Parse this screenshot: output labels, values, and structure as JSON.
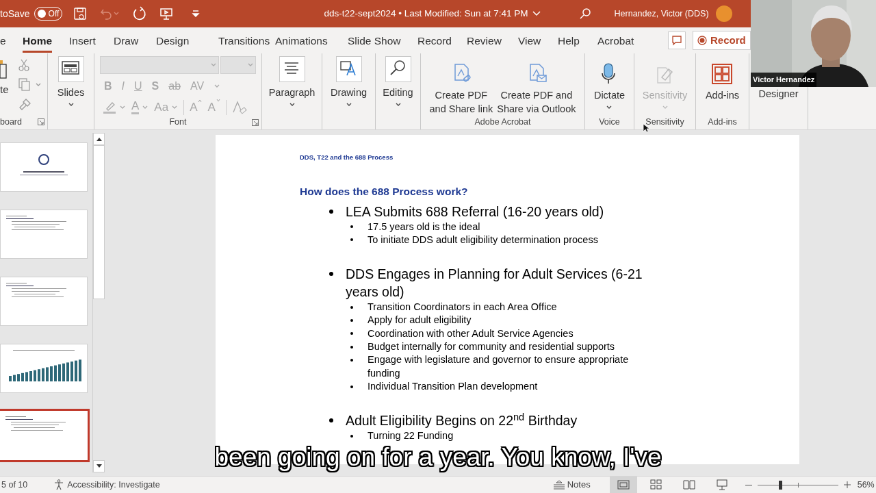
{
  "title_bar": {
    "autosave_label": "toSave",
    "autosave_toggle": {
      "label": "Off",
      "on": false
    },
    "undo_disabled": true,
    "document_title": "dds-t22-sept2024 • Last Modified: Sun at 7:41 PM",
    "user_name": "Hernandez, Victor (DDS)"
  },
  "tabs": [
    {
      "label": "e",
      "selected": false
    },
    {
      "label": "Home",
      "selected": true
    },
    {
      "label": "Insert",
      "selected": false
    },
    {
      "label": "Draw",
      "selected": false
    },
    {
      "label": "Design",
      "selected": false
    },
    {
      "label": "Transitions",
      "selected": false
    },
    {
      "label": "Animations",
      "selected": false
    },
    {
      "label": "Slide Show",
      "selected": false
    },
    {
      "label": "Record",
      "selected": false
    },
    {
      "label": "Review",
      "selected": false
    },
    {
      "label": "View",
      "selected": false
    },
    {
      "label": "Help",
      "selected": false
    },
    {
      "label": "Acrobat",
      "selected": false
    }
  ],
  "record_button": {
    "label": "Record"
  },
  "ribbon": {
    "groups": [
      {
        "kind": "clipboard",
        "label": "board",
        "paste_label": "te"
      },
      {
        "kind": "buttons",
        "buttons": [
          {
            "kind": "layout",
            "lines": [
              "Slides"
            ],
            "dropdown": true,
            "disabled": false
          }
        ]
      },
      {
        "kind": "font",
        "label": "Font",
        "row1": [
          {
            "label": "B",
            "kind": "bold",
            "disabled": true
          },
          {
            "label": "I",
            "kind": "italic",
            "disabled": true
          },
          {
            "label": "U",
            "kind": "underline",
            "disabled": true
          },
          {
            "label": "S",
            "kind": "shadow",
            "disabled": true
          },
          {
            "label": "ab",
            "kind": "strike",
            "disabled": true
          },
          {
            "label": "AV",
            "kind": "spacing",
            "disabled": true
          }
        ],
        "row2": [
          {
            "label": "A",
            "kind": "color",
            "disabled": true
          },
          {
            "label": "Aa",
            "kind": "case",
            "disabled": true
          },
          {
            "label": "A",
            "kind": "grow",
            "disabled": true
          },
          {
            "label": "A",
            "kind": "shrink",
            "disabled": true
          }
        ]
      },
      {
        "kind": "buttons",
        "buttons": [
          {
            "kind": "paragraph",
            "lines": [
              "Paragraph"
            ],
            "dropdown": true,
            "disabled": false
          }
        ]
      },
      {
        "kind": "buttons",
        "buttons": [
          {
            "kind": "drawing",
            "lines": [
              "Drawing"
            ],
            "dropdown": true,
            "disabled": false
          }
        ]
      },
      {
        "kind": "buttons",
        "buttons": [
          {
            "kind": "editing",
            "lines": [
              "Editing"
            ],
            "dropdown": true,
            "disabled": false
          }
        ]
      },
      {
        "kind": "buttons",
        "label": "Adobe Acrobat",
        "buttons": [
          {
            "kind": "pdf-link",
            "lines": [
              "Create PDF",
              "and Share link"
            ],
            "dropdown": false,
            "disabled": false
          },
          {
            "kind": "pdf-mail",
            "lines": [
              "Create PDF and",
              "Share via Outlook"
            ],
            "dropdown": false,
            "disabled": false
          }
        ]
      },
      {
        "kind": "buttons",
        "label": "Voice",
        "buttons": [
          {
            "kind": "mic",
            "lines": [
              "Dictate"
            ],
            "dropdown": true,
            "disabled": false
          }
        ]
      },
      {
        "kind": "buttons",
        "label": "Sensitivity",
        "buttons": [
          {
            "kind": "sensitivity",
            "lines": [
              "Sensitivity"
            ],
            "dropdown": true,
            "disabled": true
          }
        ]
      },
      {
        "kind": "buttons",
        "label": "Add-ins",
        "buttons": [
          {
            "kind": "addins",
            "lines": [
              "Add-ins"
            ],
            "dropdown": false,
            "disabled": false
          }
        ]
      },
      {
        "kind": "buttons",
        "buttons": [
          {
            "kind": "none",
            "lines": [
              "Designer"
            ],
            "dropdown": false,
            "disabled": false
          }
        ]
      }
    ]
  },
  "thumbnails": [
    {
      "kind": "title",
      "selected": false
    },
    {
      "kind": "list",
      "selected": false
    },
    {
      "kind": "list",
      "selected": false
    },
    {
      "kind": "chart",
      "selected": false
    },
    {
      "kind": "list",
      "selected": true
    }
  ],
  "slide": {
    "header": "DDS, T22 and the 688 Process",
    "title": "How does the 688 Process work?",
    "bullets": [
      {
        "text": "LEA Submits 688 Referral (16-20 years old)",
        "children": [
          {
            "text": "17.5 years old is the ideal"
          },
          {
            "text": "To initiate DDS adult eligibility determination process"
          }
        ]
      },
      {
        "text": "DDS Engages in Planning for Adult Services (6-21 years old)",
        "children": [
          {
            "text": "Transition Coordinators in each Area Office"
          },
          {
            "text": "Apply for adult eligibility"
          },
          {
            "text": "Coordination with other Adult Service Agencies"
          },
          {
            "text": "Budget internally for community and residential supports"
          },
          {
            "text": "Engage with legislature and governor to ensure appropriate funding"
          },
          {
            "text": "Individual Transition Plan development"
          }
        ]
      },
      {
        "text": "Adult Eligibility Begins on 22$^{nd}$ Birthday",
        "children": [
          {
            "text": "Turning 22 Funding"
          }
        ]
      }
    ]
  },
  "video": {
    "name_label": "Victor Hernandez"
  },
  "caption": "been going on for a year. You know, I've",
  "status_bar": {
    "slide_counter": "5 of 10",
    "accessibility": "Accessibility: Investigate",
    "notes": "Notes",
    "views": [
      {
        "kind": "normal",
        "selected": true
      },
      {
        "kind": "sorter",
        "selected": false
      },
      {
        "kind": "reading",
        "selected": false
      },
      {
        "kind": "show",
        "selected": false
      }
    ],
    "zoom": {
      "level": 0.28,
      "percent": "56%"
    }
  }
}
